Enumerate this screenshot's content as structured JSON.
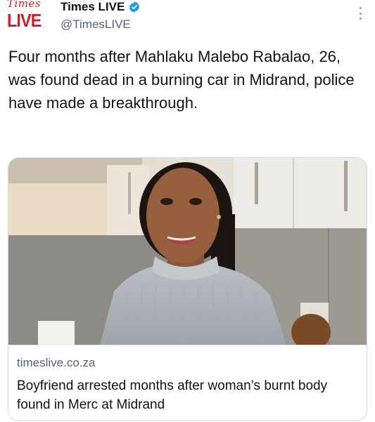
{
  "account": {
    "logo_top": "Times",
    "logo_bottom": "LIVE",
    "display_name": "Times LIVE",
    "handle": "@TimesLIVE",
    "verified": true,
    "brand_color": "#c7202a",
    "verified_color": "#1d9bf0"
  },
  "tweet": {
    "text": "Four months after Mahlaku Malebo Rabalao, 26, was found dead in a burning car in Midrand, police have made a breakthrough."
  },
  "card": {
    "domain": "timeslive.co.za",
    "title": "Boyfriend arrested months after woman’s burnt body found in Merc at Midrand",
    "image_icon": "photo-of-woman"
  },
  "icons": {
    "more": "more-options-icon",
    "verified": "verified-badge-icon"
  }
}
